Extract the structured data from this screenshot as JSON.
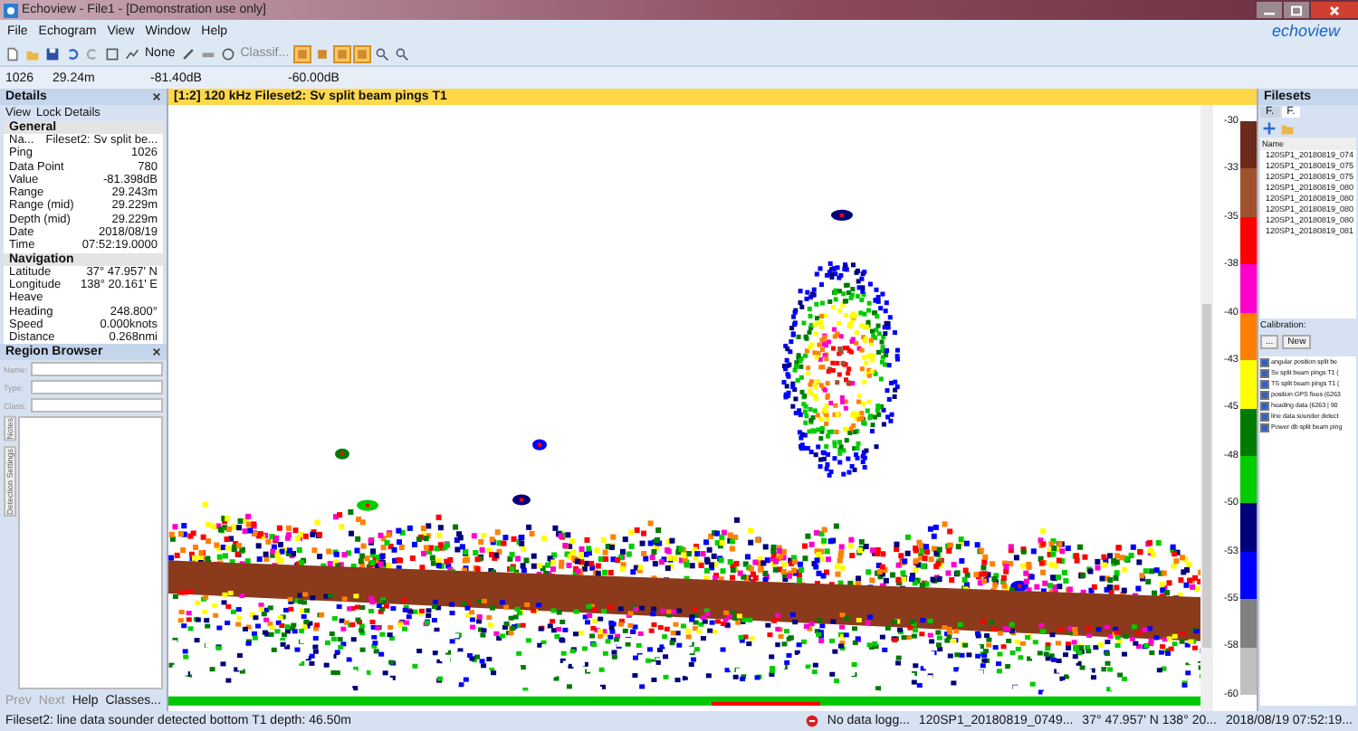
{
  "window": {
    "title": "Echoview - File1 - [Demonstration use only]"
  },
  "menu": [
    "File",
    "Echogram",
    "View",
    "Window",
    "Help"
  ],
  "logo": "echoview",
  "toolbar": {
    "line_mode": "None",
    "class_field": "Classif...",
    "toggles": [
      {
        "selected": true
      },
      {
        "selected": false
      },
      {
        "selected": true
      },
      {
        "selected": true
      }
    ]
  },
  "readout": [
    "1026",
    "29.24m",
    "-81.40dB",
    "-60.00dB"
  ],
  "details": {
    "title": "Details",
    "menu": [
      "View",
      "Lock Details"
    ],
    "groups": [
      {
        "title": "General",
        "rows": [
          {
            "name": "Na...",
            "value": "Fileset2: Sv split be..."
          },
          {
            "name": "Ping",
            "value": "1026"
          },
          {
            "name": "Data Point",
            "value": "780"
          },
          {
            "name": "Value",
            "value": "-81.398dB"
          },
          {
            "name": "Range",
            "value": "29.243m"
          },
          {
            "name": "Range (mid)",
            "value": "29.229m"
          },
          {
            "name": "Depth (mid)",
            "value": "29.229m"
          },
          {
            "name": "Date",
            "value": "2018/08/19"
          },
          {
            "name": "Time",
            "value": "07:52:19.0000"
          }
        ]
      },
      {
        "title": "Navigation",
        "rows": [
          {
            "name": "Latitude",
            "value": "37° 47.957' N"
          },
          {
            "name": "Longitude",
            "value": "138° 20.161' E"
          },
          {
            "name": "Heave",
            "value": ""
          },
          {
            "name": "Heading",
            "value": "248.800°"
          },
          {
            "name": "Speed",
            "value": "0.000knots"
          },
          {
            "name": "Distance",
            "value": "0.268nmi"
          }
        ]
      }
    ]
  },
  "region_browser": {
    "title": "Region Browser",
    "fields": [
      "Name:",
      "Type:",
      "Class:"
    ],
    "side_tabs": [
      "Notes",
      "Detection Settings"
    ],
    "buttons": [
      {
        "label": "Prev",
        "disabled": true
      },
      {
        "label": "Next",
        "disabled": true
      },
      {
        "label": "Help",
        "disabled": false
      },
      {
        "label": "Classes...",
        "disabled": false
      }
    ]
  },
  "echogram": {
    "title": "[1:2] 120 kHz Fileset2: Sv split beam pings T1"
  },
  "scale": {
    "ticks": [
      "-30",
      "-33",
      "-35",
      "-38",
      "-40",
      "-43",
      "-45",
      "-48",
      "-50",
      "-53",
      "-55",
      "-58",
      "-60"
    ],
    "bands": [
      {
        "color": "#6b2a1a"
      },
      {
        "color": "#a0522d"
      },
      {
        "color": "#ff0000"
      },
      {
        "color": "#ff00cc"
      },
      {
        "color": "#ff8000"
      },
      {
        "color": "#ffff00"
      },
      {
        "color": "#007a00"
      },
      {
        "color": "#00cc00"
      },
      {
        "color": "#00007a"
      },
      {
        "color": "#0000ff"
      },
      {
        "color": "#808080"
      },
      {
        "color": "#c0c0c0"
      }
    ]
  },
  "filesets": {
    "title": "Filesets",
    "tabs": [
      {
        "label": "F.",
        "selected": false
      },
      {
        "label": "F.",
        "selected": true
      }
    ],
    "column": "Name",
    "files": [
      "120SP1_20180819_074",
      "120SP1_20180819_075",
      "120SP1_20180819_075",
      "120SP1_20180819_080",
      "120SP1_20180819_080",
      "120SP1_20180819_080",
      "120SP1_20180819_080",
      "120SP1_20180819_081"
    ],
    "calibration_label": "Calibration:",
    "calibration_buttons": [
      "...",
      "New"
    ],
    "variables": [
      {
        "label": "angular position split be",
        "checked": true
      },
      {
        "label": "Sv split beam pings T1 (",
        "checked": true
      },
      {
        "label": "TS split beam pings T1 (",
        "checked": true
      },
      {
        "label": "position GPS fixes (6263",
        "checked": true
      },
      {
        "label": "heading data (6263 | 90",
        "checked": true
      },
      {
        "label": "line data sounder detect",
        "checked": true
      },
      {
        "label": "Power db split beam ping",
        "checked": true
      }
    ]
  },
  "status_bar": {
    "message": "Fileset2: line data sounder detected bottom T1 depth: 46.50m",
    "logging": "No data logg...",
    "file": "120SP1_20180819_0749...",
    "position": "37° 47.957' N 138° 20...",
    "time": "2018/08/19 07:52:19..."
  }
}
